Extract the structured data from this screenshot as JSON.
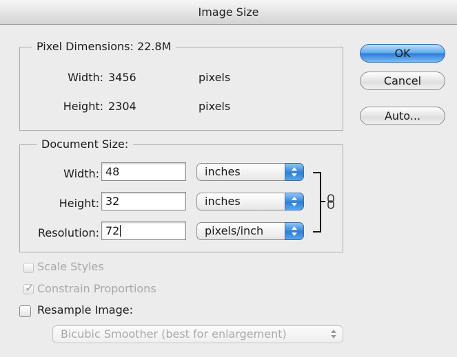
{
  "window": {
    "title": "Image Size"
  },
  "pixel_dimensions": {
    "legend": "Pixel Dimensions:  22.8M",
    "width_label": "Width:",
    "width_value": "3456",
    "width_unit": "pixels",
    "height_label": "Height:",
    "height_value": "2304",
    "height_unit": "pixels"
  },
  "document_size": {
    "legend": "Document Size:",
    "width_label": "Width:",
    "width_value": "48",
    "width_unit": "inches",
    "height_label": "Height:",
    "height_value": "32",
    "height_unit": "inches",
    "resolution_label": "Resolution:",
    "resolution_value": "72",
    "resolution_unit": "pixels/inch"
  },
  "buttons": {
    "ok": "OK",
    "cancel": "Cancel",
    "auto": "Auto..."
  },
  "options": {
    "scale_styles": "Scale Styles",
    "scale_styles_checked": false,
    "constrain_proportions": "Constrain Proportions",
    "constrain_proportions_checked": true,
    "resample_image": "Resample Image:",
    "resample_image_checked": false,
    "resample_method": "Bicubic Smoother (best for enlargement)"
  },
  "icons": {
    "link": "chain-link-icon",
    "check": "checkmark-icon",
    "stepper": "up-down-arrows-icon"
  },
  "colors": {
    "accent": "#2c7ad6",
    "background": "#ececec",
    "disabled_text": "#a8a8a8"
  }
}
